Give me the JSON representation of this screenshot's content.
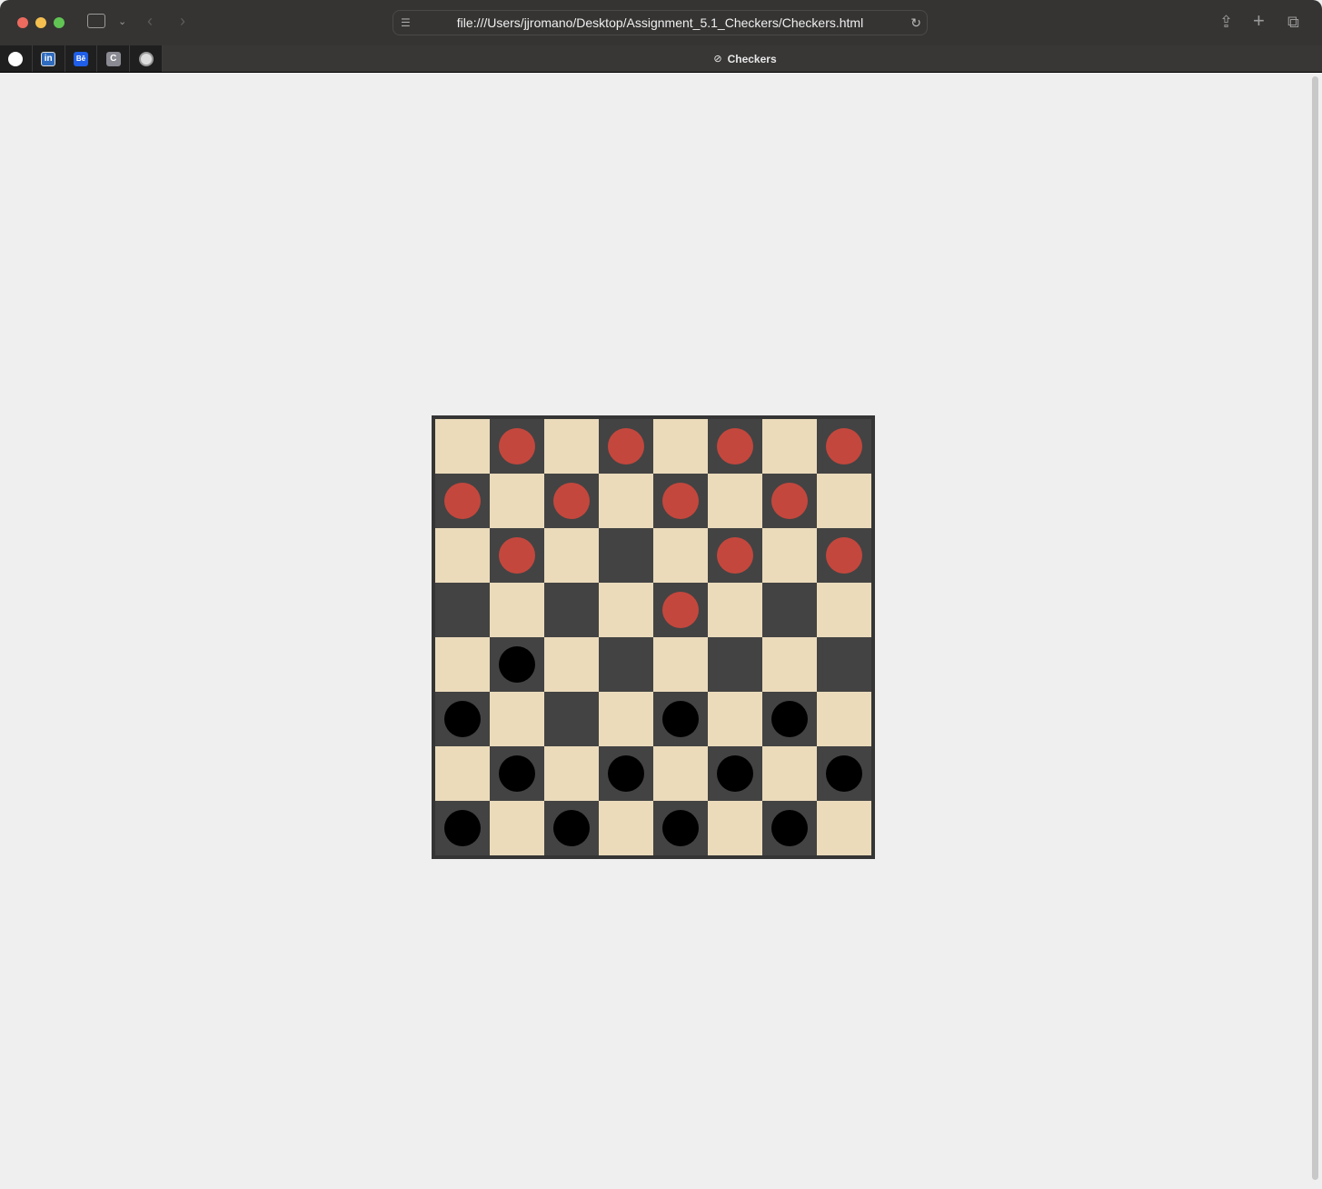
{
  "browser": {
    "url": "file:///Users/jjromano/Desktop/Assignment_5.1_Checkers/Checkers.html",
    "tab_title": "Checkers",
    "pinned_tabs": [
      {
        "name": "github",
        "label": ""
      },
      {
        "name": "linkedin",
        "label": "in"
      },
      {
        "name": "behance",
        "label": "Bē"
      },
      {
        "name": "c-site",
        "label": "C"
      },
      {
        "name": "site-5",
        "label": ""
      }
    ]
  },
  "colors": {
    "light_square": "#ebdbbb",
    "dark_square": "#434343",
    "red_piece": "#c4473d",
    "black_piece": "#000000",
    "border": "#353535"
  },
  "board": [
    "-r-r-r-r",
    "r-r-r-r-",
    "-r---r-r",
    "----r---",
    "-b------",
    "b---b-b-",
    "-b-b-b-b",
    "b-b-b-b-"
  ]
}
